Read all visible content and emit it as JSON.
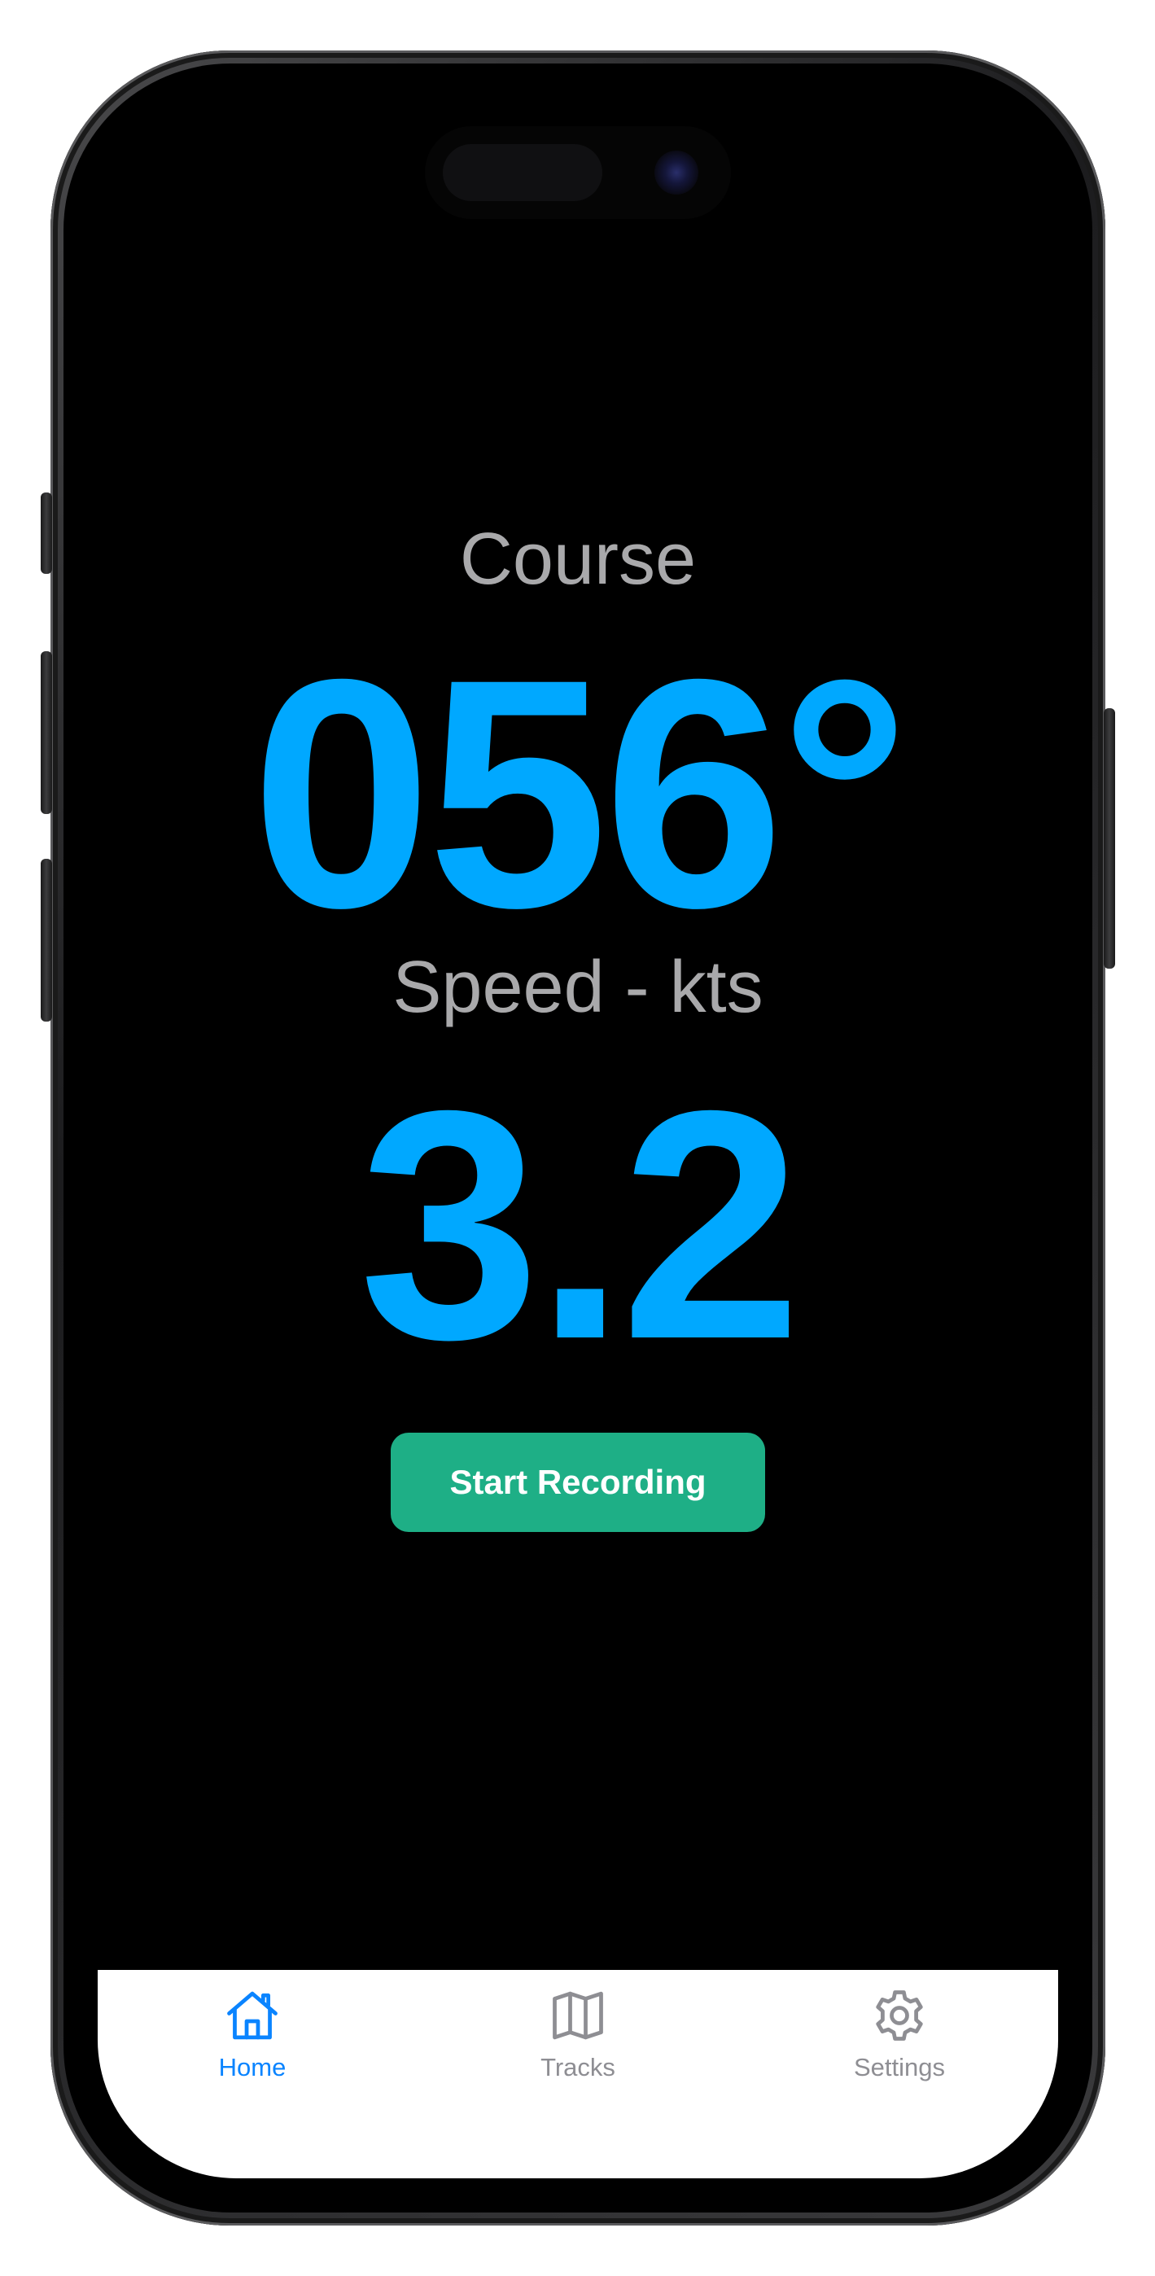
{
  "course": {
    "label": "Course",
    "value": "056°"
  },
  "speed": {
    "label": "Speed - kts",
    "value": "3.2"
  },
  "actions": {
    "record_label": "Start Recording"
  },
  "tab_bar": {
    "tabs": [
      {
        "label": "Home",
        "icon": "house-icon",
        "active": true
      },
      {
        "label": "Tracks",
        "icon": "map-icon",
        "active": false
      },
      {
        "label": "Settings",
        "icon": "gear-icon",
        "active": false
      }
    ]
  },
  "colors": {
    "accent_value": "#00a8ff",
    "record_button": "#1eaf86",
    "tab_active": "#0a84ff",
    "tab_inactive": "#8e8e93",
    "label_gray": "#a9a9ab",
    "background": "#000000"
  }
}
